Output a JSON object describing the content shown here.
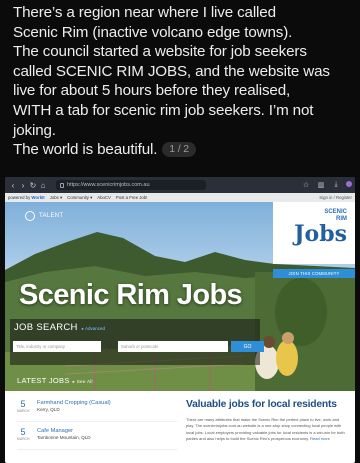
{
  "post": {
    "text": "There’s a region near where I live called\nScenic Rim (inactive volcano edge towns).\nThe council started a website for job seekers\ncalled SCENIC RIM JOBS, and the website was\nlive for about 5 hours before they realised,\nWITH a tab for scenic rim job seekers. I’m not\njoking.\nThe world is beautiful.",
    "image_counter": "1 / 2"
  },
  "browser": {
    "url": "https://www.scenicrimjobs.com.au",
    "left_icons": [
      "back-icon",
      "forward-icon",
      "reload-icon",
      "home-icon"
    ],
    "right_icons": [
      "star-icon",
      "library-icon",
      "download-icon",
      "extension-icon"
    ]
  },
  "site_nav": {
    "powered_by": "powered by",
    "brand": "WorkIt",
    "items": [
      "Jobs ▾",
      "Community ▾",
      "AboCV",
      "Post a Free Job!"
    ],
    "sign_in": "Sign in / Register"
  },
  "hero": {
    "talent_label": "TALENT",
    "logo_small_1": "SCENIC",
    "logo_small_2": "RIM",
    "logo_big": "Jobs",
    "join_button": "JOIN THIS COMMUNITY",
    "title": "Scenic Rim Jobs"
  },
  "search": {
    "label": "JOB SEARCH",
    "advanced": "▸ Advanced",
    "keyword_placeholder": "Title, industry or company",
    "location_placeholder": "Suburb or postcode",
    "go_label": "GO"
  },
  "latest": {
    "label": "LATEST JOBS",
    "see_all": "▸ See All",
    "jobs": [
      {
        "day": "5",
        "month": "MARCH",
        "title": "Farmhand Cropping (Casual)",
        "location": "Kerry, QLD"
      },
      {
        "day": "5",
        "month": "MARCH",
        "title": "Cafe Manager",
        "location": "Tamborine Mountain, QLD"
      }
    ]
  },
  "promo": {
    "title": "Valuable jobs for local residents",
    "body": "There are many attributes that make the Scenic Rim the perfect place to live, work and play. The scenicrimjobs.com.au website is a one-stop shop connecting local people with local jobs. Local employers providing valuable jobs for local residents is a win-win for both parties and also helps to build the Scenic Rim's prosperous economy.",
    "read_more": "Read more"
  },
  "colors": {
    "accent_blue": "#2f8fd6",
    "brand_blue": "#235e9f",
    "dark_bg": "#0b0b0b"
  }
}
